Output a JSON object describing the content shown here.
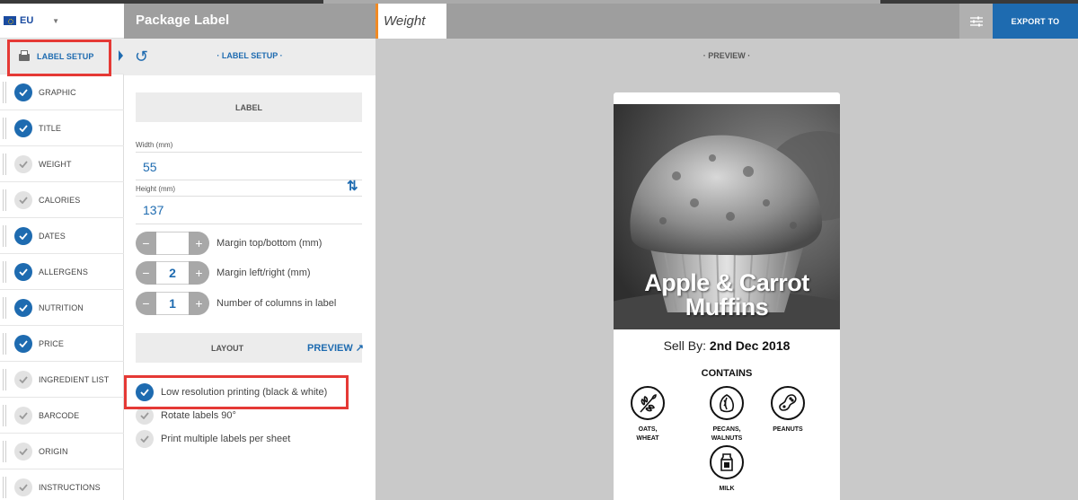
{
  "header": {
    "region_code": "EU",
    "title": "Package Label",
    "active_tab": "Weight",
    "export_label": "EXPORT TO"
  },
  "sidebar": {
    "items": [
      {
        "label": "LABEL SETUP",
        "state": "active"
      },
      {
        "label": "GRAPHIC",
        "checked": true
      },
      {
        "label": "TITLE",
        "checked": true
      },
      {
        "label": "WEIGHT",
        "checked": false
      },
      {
        "label": "CALORIES",
        "checked": false
      },
      {
        "label": "DATES",
        "checked": true
      },
      {
        "label": "ALLERGENS",
        "checked": true
      },
      {
        "label": "NUTRITION",
        "checked": true
      },
      {
        "label": "PRICE",
        "checked": true
      },
      {
        "label": "INGREDIENT LIST",
        "checked": false
      },
      {
        "label": "BARCODE",
        "checked": false
      },
      {
        "label": "ORIGIN",
        "checked": false
      },
      {
        "label": "INSTRUCTIONS",
        "checked": false
      }
    ]
  },
  "setup": {
    "panel_title": "LABEL SETUP",
    "label_section": "LABEL",
    "width_label": "Width (mm)",
    "width_value": "55",
    "height_label": "Height (mm)",
    "height_value": "137",
    "margin_tb_label": "Margin top/bottom (mm)",
    "margin_tb_value": "",
    "margin_lr_label": "Margin left/right (mm)",
    "margin_lr_value": "2",
    "columns_label": "Number of columns in label",
    "columns_value": "1",
    "layout_section": "LAYOUT",
    "preview_link": "PREVIEW ↗",
    "options": [
      {
        "label": "Low resolution printing (black & white)",
        "checked": true
      },
      {
        "label": "Rotate labels 90°",
        "checked": false
      },
      {
        "label": "Print multiple labels per sheet",
        "checked": false
      }
    ]
  },
  "preview": {
    "title": "PREVIEW",
    "product_line1": "Apple & Carrot",
    "product_line2": "Muffins",
    "sell_by_label": "Sell By:",
    "sell_by_date": "2nd Dec 2018",
    "contains_label": "CONTAINS",
    "allergens": [
      {
        "name1": "OATS,",
        "name2": "WHEAT",
        "icon": "wheat-icon"
      },
      {
        "name1": "PECANS,",
        "name2": "WALNUTS",
        "icon": "nut-icon"
      },
      {
        "name1": "PEANUTS",
        "name2": "",
        "icon": "peanut-icon"
      },
      {
        "name1": "MILK",
        "name2": "",
        "icon": "milk-icon"
      }
    ]
  },
  "colors": {
    "accent": "#1e6bb0",
    "highlight": "#e53935",
    "tab_marker": "#f08a24"
  }
}
